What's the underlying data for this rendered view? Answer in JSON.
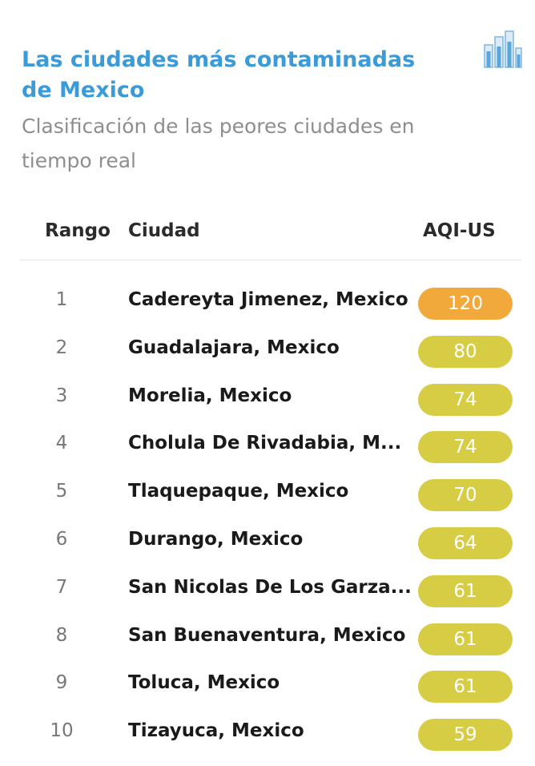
{
  "header": {
    "title": "Las ciudades más contaminadas de Mexico",
    "subtitle": "Clasificación de las peores ciudades en tiempo real",
    "icon": "bar-chart-icon"
  },
  "table": {
    "columns": [
      "Rango",
      "Ciudad",
      "AQI-US"
    ],
    "rows": [
      {
        "rank": "1",
        "city": "Cadereyta Jimenez, Mexico",
        "aqi": "120",
        "color": "#f2a93b"
      },
      {
        "rank": "2",
        "city": "Guadalajara, Mexico",
        "aqi": "80",
        "color": "#d6cd44"
      },
      {
        "rank": "3",
        "city": "Morelia, Mexico",
        "aqi": "74",
        "color": "#d6cd44"
      },
      {
        "rank": "4",
        "city": "Cholula De Rivadabia, M...",
        "aqi": "74",
        "color": "#d6cd44"
      },
      {
        "rank": "5",
        "city": "Tlaquepaque, Mexico",
        "aqi": "70",
        "color": "#d6cd44"
      },
      {
        "rank": "6",
        "city": "Durango, Mexico",
        "aqi": "64",
        "color": "#d6cd44"
      },
      {
        "rank": "7",
        "city": "San Nicolas De Los Garza...",
        "aqi": "61",
        "color": "#d6cd44"
      },
      {
        "rank": "8",
        "city": "San Buenaventura, Mexico",
        "aqi": "61",
        "color": "#d6cd44"
      },
      {
        "rank": "9",
        "city": "Toluca, Mexico",
        "aqi": "61",
        "color": "#d6cd44"
      },
      {
        "rank": "10",
        "city": "Tizayuca, Mexico",
        "aqi": "59",
        "color": "#d6cd44"
      }
    ]
  },
  "colors": {
    "title": "#3a9bd8",
    "subtitle": "#8e8e8e",
    "unhealthy_sensitive": "#f2a93b",
    "moderate": "#d6cd44"
  }
}
